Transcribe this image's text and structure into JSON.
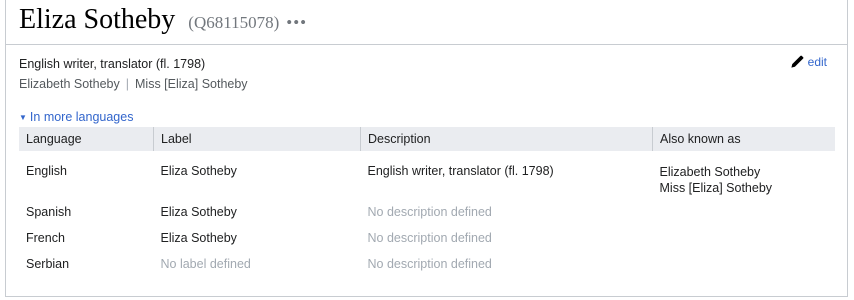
{
  "entity": {
    "label": "Eliza Sotheby",
    "qid": "(Q68115078)",
    "more_dots": "•••",
    "description": "English writer, translator (fl. 1798)",
    "aliases": [
      "Elizabeth Sotheby",
      "Miss [Eliza] Sotheby"
    ],
    "alias_separator": "|"
  },
  "edit": {
    "label": "edit",
    "icon": "pencil-icon"
  },
  "more_languages": {
    "label": "In more languages",
    "icon": "triangle-down-icon"
  },
  "table": {
    "headers": [
      "Language",
      "Label",
      "Description",
      "Also known as"
    ],
    "rows": [
      {
        "language": "English",
        "label": "Eliza Sotheby",
        "description": "English writer, translator (fl. 1798)",
        "aliases": [
          "Elizabeth Sotheby",
          "Miss [Eliza] Sotheby"
        ]
      },
      {
        "language": "Spanish",
        "label": "Eliza Sotheby",
        "description": "No description defined",
        "aliases": []
      },
      {
        "language": "French",
        "label": "Eliza Sotheby",
        "description": "No description defined",
        "aliases": []
      },
      {
        "language": "Serbian",
        "label": "No label defined",
        "description": "No description defined",
        "aliases": []
      }
    ]
  },
  "colors": {
    "link": "#3366cc",
    "muted": "#a2a9b1",
    "header_bg": "#eaecf0",
    "border": "#c8ccd1"
  }
}
